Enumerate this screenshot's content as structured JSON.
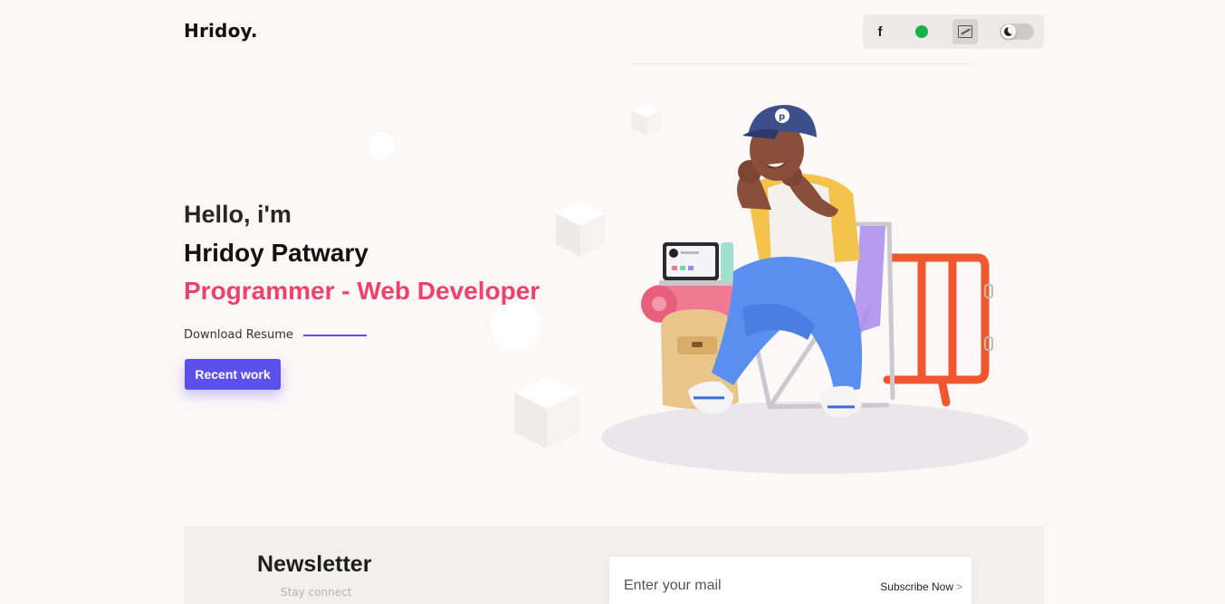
{
  "header": {
    "logo": "Hridoy.",
    "social": [
      "facebook-icon",
      "whatsapp-icon",
      "resume-icon"
    ],
    "theme_toggle": "dark-mode-toggle"
  },
  "hero": {
    "greeting": "Hello, i'm",
    "name": "Hridoy Patwary",
    "role": "Programmer - Web Developer",
    "resume_link": "Download Resume",
    "cta_label": "Recent work"
  },
  "newsletter": {
    "title": "Newsletter",
    "subtitle": "Stay connect",
    "email_placeholder": "Enter your mail",
    "subscribe_label": "Subscribe Now",
    "subscribe_icon": "chevron-right-icon"
  },
  "colors": {
    "accent": "#5b50ea",
    "highlight": "#f0416c",
    "background": "#fcf8f8"
  }
}
